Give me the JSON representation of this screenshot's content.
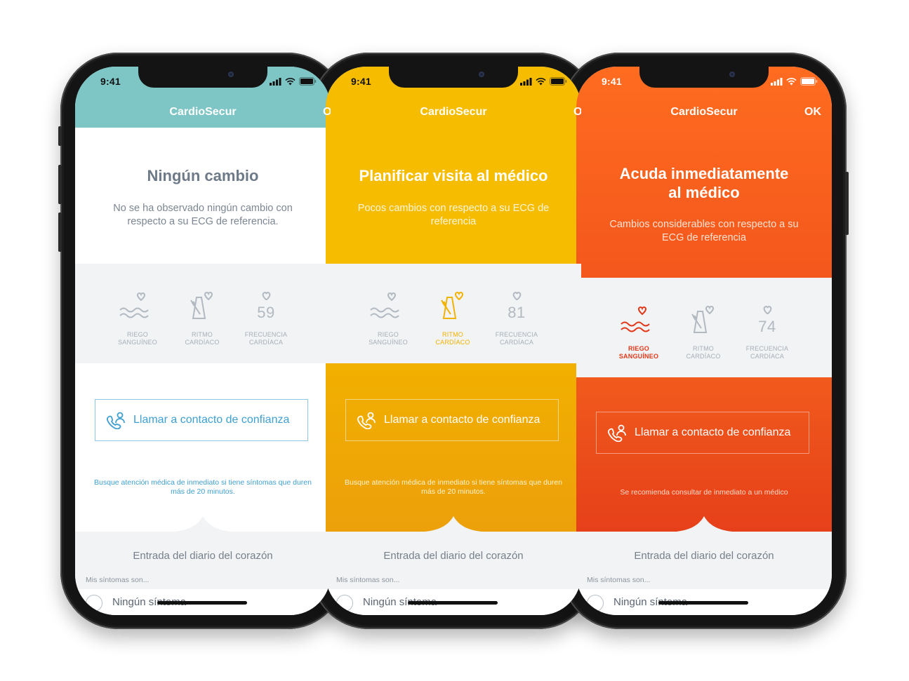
{
  "status_bar": {
    "time": "9:41"
  },
  "app": {
    "title": "CardioSecur",
    "ok_label": "OK"
  },
  "phones": [
    {
      "theme": "teal",
      "header": {
        "title": "Ningún cambio",
        "subtitle": "No se ha observado ningún cambio con respecto a su ECG de referencia."
      },
      "metrics": {
        "blood_flow": {
          "label_line1": "RIEGO",
          "label_line2": "SANGUÍNEO"
        },
        "heart_rhythm": {
          "label_line1": "RITMO",
          "label_line2": "CARDÍACO"
        },
        "heart_rate": {
          "value": "59",
          "label_line1": "FRECUENCIA",
          "label_line2": "CARDÍACA"
        }
      },
      "cta_label": "Llamar a contacto de confianza",
      "note": "Busque atención médica de inmediato si tiene síntomas que duren más de 20 minutos.",
      "highlight": "none"
    },
    {
      "theme": "yellow",
      "header": {
        "title": "Planificar visita al médico",
        "subtitle": "Pocos cambios con respecto a su ECG de referencia"
      },
      "metrics": {
        "blood_flow": {
          "label_line1": "RIEGO",
          "label_line2": "SANGUÍNEO"
        },
        "heart_rhythm": {
          "label_line1": "RITMO",
          "label_line2": "CARDÍACO"
        },
        "heart_rate": {
          "value": "81",
          "label_line1": "FRECUENCIA",
          "label_line2": "CARDÍACA"
        }
      },
      "cta_label": "Llamar a contacto de confianza",
      "note": "Busque atención médica de inmediato si tiene síntomas que duren más de 20 minutos.",
      "highlight": "heart_rhythm"
    },
    {
      "theme": "orange",
      "header": {
        "title_line1": "Acuda inmediatamente",
        "title_line2": "al médico",
        "subtitle": "Cambios considerables con respecto a su ECG de referencia"
      },
      "metrics": {
        "blood_flow": {
          "label_line1": "RIEGO",
          "label_line2": "SANGUÍNEO"
        },
        "heart_rhythm": {
          "label_line1": "RITMO",
          "label_line2": "CARDÍACO"
        },
        "heart_rate": {
          "value": "74",
          "label_line1": "FRECUENCIA",
          "label_line2": "CARDÍACA"
        }
      },
      "cta_label": "Llamar a contacto de confianza",
      "note": "Se recomienda consultar de inmediato a un médico",
      "highlight": "blood_flow"
    }
  ],
  "diary": {
    "title": "Entrada del diario del corazón",
    "hint": "Mis síntomas son...",
    "first_option": "Ningún síntoma"
  },
  "colors": {
    "teal": "#7ec5c6",
    "yellow_top": "#f6bc00",
    "yellow_bottom": "#eea108",
    "orange_top": "#ff6a1f",
    "orange_bottom": "#e8401a",
    "link_blue": "#3f9fd0",
    "title_grey": "#6e7a88",
    "metric_grey": "#b2b9c0",
    "page_bg": "#f1f3f5"
  }
}
